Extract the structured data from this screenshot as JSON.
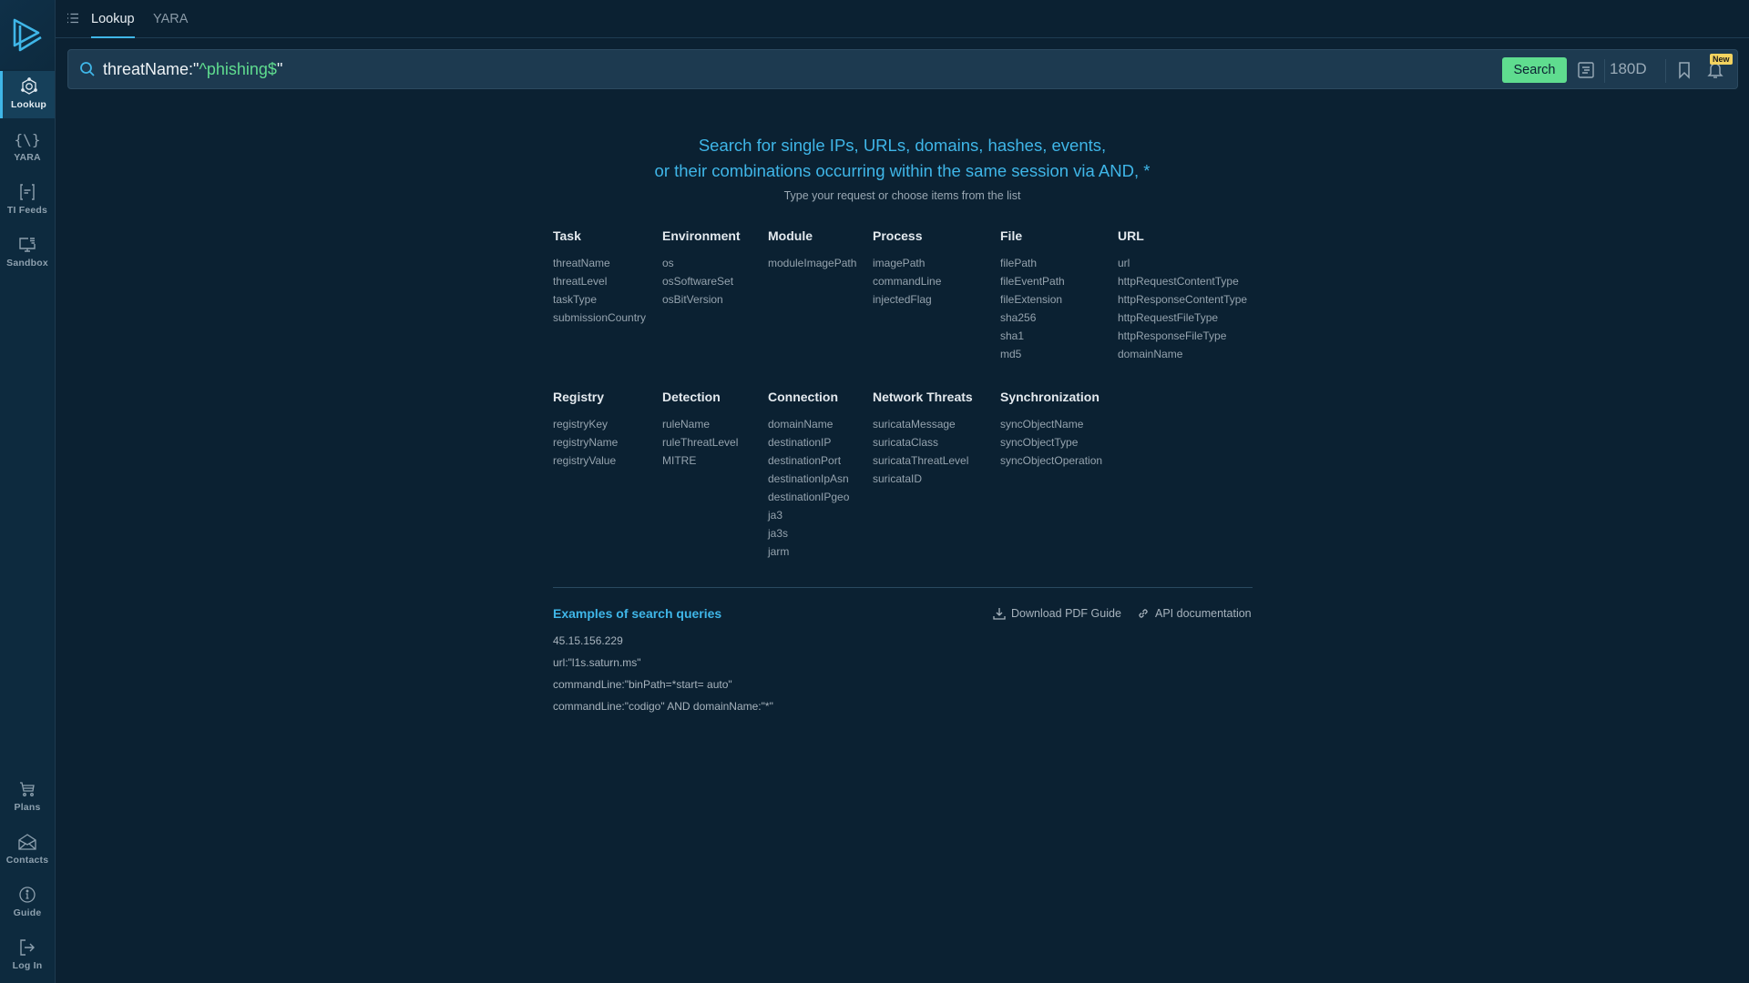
{
  "sidebar": {
    "logo": "anyrun-logo",
    "top_items": [
      {
        "label": "Lookup",
        "icon": "lookup-icon",
        "active": true
      },
      {
        "label": "YARA",
        "icon": "yara-braces-icon"
      },
      {
        "label": "TI Feeds",
        "icon": "feeds-icon"
      },
      {
        "label": "Sandbox",
        "icon": "sandbox-monitor-icon"
      }
    ],
    "bottom_items": [
      {
        "label": "Plans",
        "icon": "cart-icon"
      },
      {
        "label": "Contacts",
        "icon": "envelope-icon"
      },
      {
        "label": "Guide",
        "icon": "info-icon"
      },
      {
        "label": "Log In",
        "icon": "login-icon"
      }
    ]
  },
  "topbar": {
    "tabs": [
      {
        "label": "Lookup",
        "active": true
      },
      {
        "label": "YARA",
        "active": false
      }
    ]
  },
  "search": {
    "query_prefix": "threatName:\"",
    "query_accent": "^phishing$",
    "query_suffix": "\"",
    "button_label": "Search",
    "period": "180D",
    "new_badge": "New"
  },
  "hero": {
    "line1": "Search for single IPs, URLs, domains, hashes, events,",
    "line2": "or their combinations occurring within the same session via AND, *",
    "subtitle": "Type your request or choose items from the list"
  },
  "categories_row1": [
    {
      "title": "Task",
      "items": [
        "threatName",
        "threatLevel",
        "taskType",
        "submissionCountry"
      ]
    },
    {
      "title": "Environment",
      "items": [
        "os",
        "osSoftwareSet",
        "osBitVersion"
      ]
    },
    {
      "title": "Module",
      "items": [
        "moduleImagePath"
      ]
    },
    {
      "title": "Process",
      "items": [
        "imagePath",
        "commandLine",
        "injectedFlag"
      ]
    },
    {
      "title": "File",
      "items": [
        "filePath",
        "fileEventPath",
        "fileExtension",
        "sha256",
        "sha1",
        "md5"
      ]
    },
    {
      "title": "URL",
      "items": [
        "url",
        "httpRequestContentType",
        "httpResponseContentType",
        "httpRequestFileType",
        "httpResponseFileType",
        "domainName"
      ]
    }
  ],
  "categories_row2": [
    {
      "title": "Registry",
      "items": [
        "registryKey",
        "registryName",
        "registryValue"
      ]
    },
    {
      "title": "Detection",
      "items": [
        "ruleName",
        "ruleThreatLevel",
        "MITRE"
      ]
    },
    {
      "title": "Connection",
      "items": [
        "domainName",
        "destinationIP",
        "destinationPort",
        "destinationIpAsn",
        "destinationIPgeo",
        "ja3",
        "ja3s",
        "jarm"
      ]
    },
    {
      "title": "Network Threats",
      "items": [
        "suricataMessage",
        "suricataClass",
        "suricataThreatLevel",
        "suricataID"
      ]
    },
    {
      "title": "Synchronization",
      "items": [
        "syncObjectName",
        "syncObjectType",
        "syncObjectOperation"
      ]
    }
  ],
  "examples": {
    "title": "Examples of search queries",
    "queries": [
      "45.15.156.229",
      "url:\"l1s.saturn.ms\"",
      "commandLine:\"binPath=*start= auto\"",
      "commandLine:\"codigo\" AND domainName:\"*\""
    ],
    "download_label": "Download PDF Guide",
    "api_label": "API documentation"
  },
  "colors": {
    "background": "#0b2132",
    "sidebar": "#0d2a3e",
    "accent_blue": "#3fb6e8",
    "accent_green": "#5fdc8f",
    "badge_yellow": "#f3d35f"
  }
}
